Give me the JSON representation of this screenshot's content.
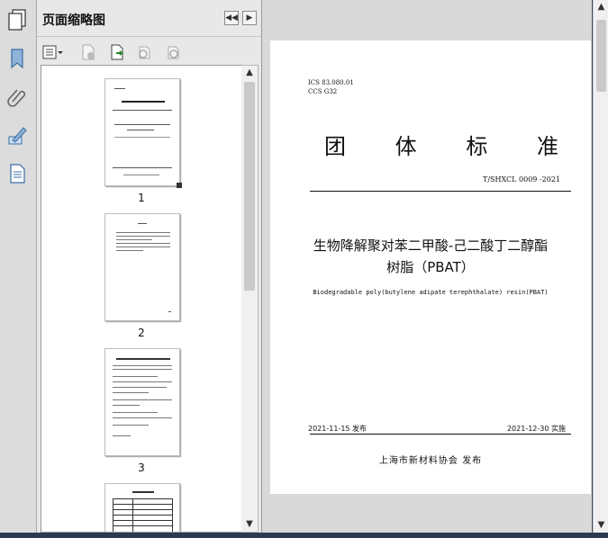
{
  "panel": {
    "title": "页面缩略图",
    "thumbnails": [
      {
        "label": "1"
      },
      {
        "label": "2"
      },
      {
        "label": "3"
      },
      {
        "label": ""
      }
    ]
  },
  "document": {
    "ics": "ICS 83.080.01",
    "ccs": "CCS G32",
    "title_chars": [
      "团",
      "体",
      "标",
      "准"
    ],
    "code": "T/SHXCL 0009 -2021",
    "name_line1": "生物降解聚对苯二甲酸-己二酸丁二醇酯",
    "name_line2": "树脂（PBAT）",
    "english_name": "Biodegradable poly(butylene adipate terephthalate) resin(PBAT)",
    "publish_date": "2021-11-15 发布",
    "implement_date": "2021-12-30 实施",
    "issuer": "上海市新材料协会  发布"
  },
  "colors": {
    "panel_bg": "#e8e8e8",
    "viewer_bg": "#d9d9d9",
    "rail_bg": "#dcdcdc",
    "icon_blue": "#3b6ea5"
  }
}
